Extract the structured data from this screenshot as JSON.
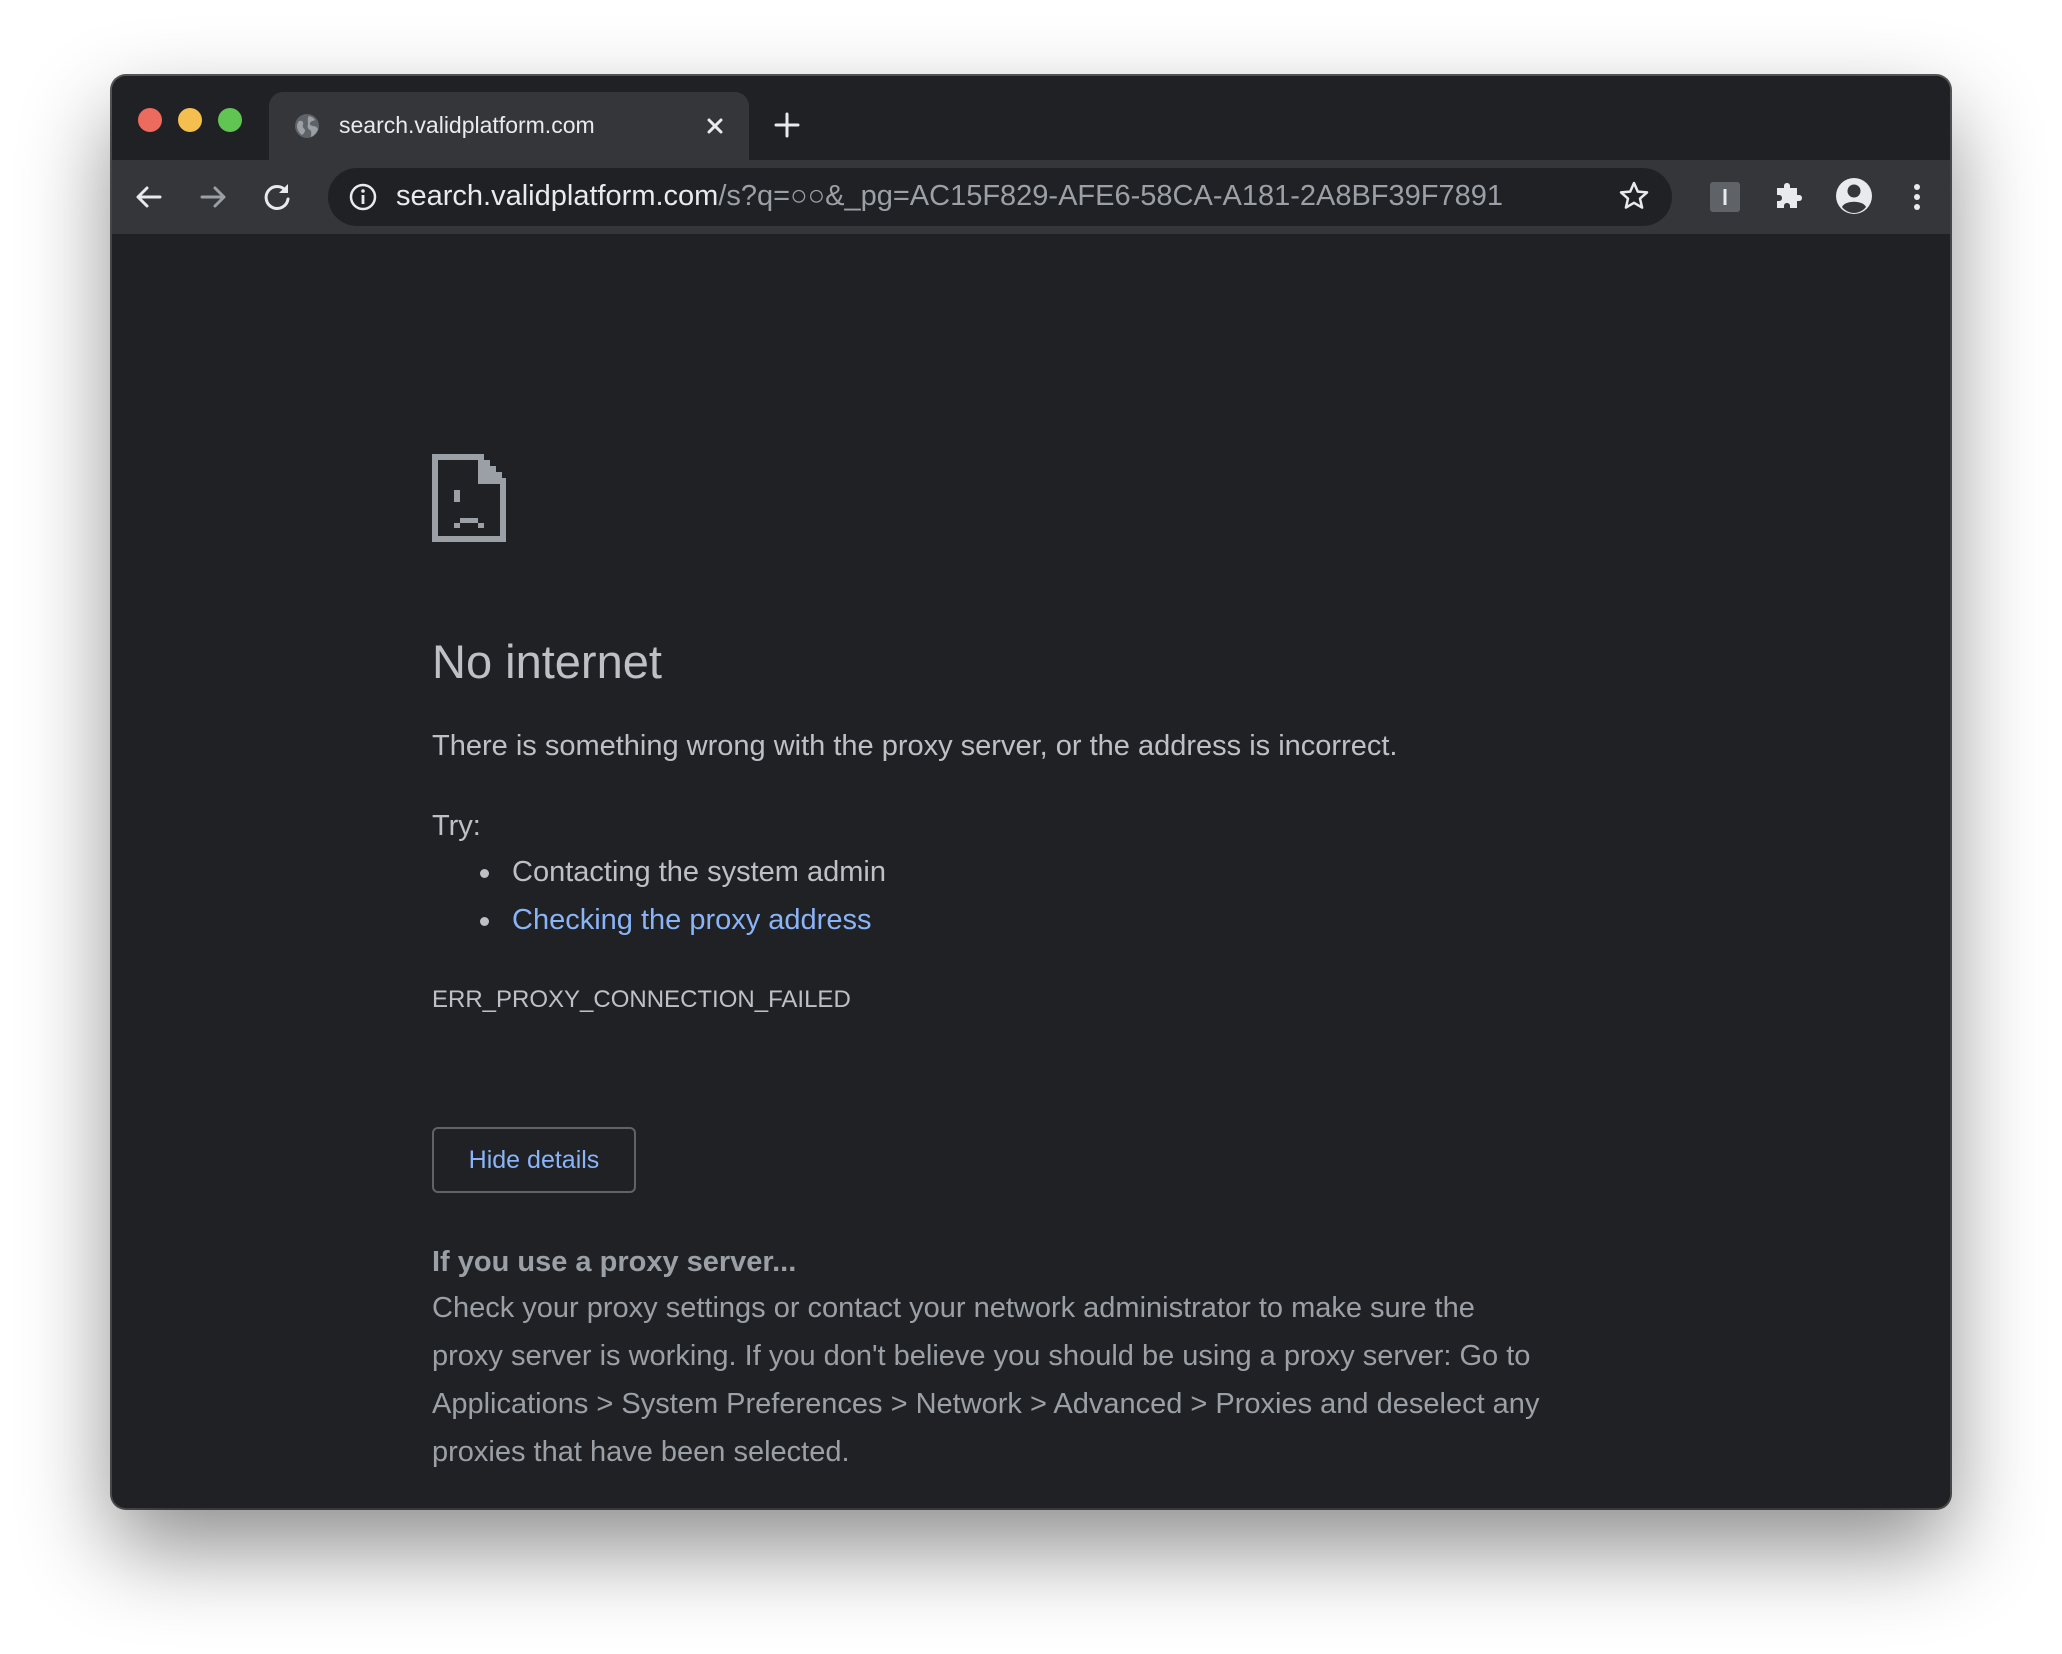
{
  "tab": {
    "title": "search.validplatform.com",
    "favicon": "globe-icon",
    "close_icon": "close-icon",
    "new_tab_icon": "plus-icon"
  },
  "toolbar": {
    "back_icon": "arrow-left-icon",
    "forward_icon": "arrow-right-icon",
    "reload_icon": "reload-icon",
    "omnibox": {
      "site_info_icon": "info-icon",
      "url_host": "search.validplatform.com",
      "url_path": "/s?q=○○&_pg=AC15F829-AFE6-58CA-A181-2A8BF39F7891",
      "bookmark_icon": "star-icon"
    },
    "extension_icon": "extension-badge-icon",
    "extensions_icon": "puzzle-icon",
    "profile_icon": "account-icon",
    "menu_icon": "kebab-menu-icon"
  },
  "error_page": {
    "icon": "sad-page-icon",
    "heading": "No internet",
    "summary": "There is something wrong with the proxy server, or the address is incorrect.",
    "try_label": "Try:",
    "suggestions": [
      "Contacting the system admin",
      "Checking the proxy address"
    ],
    "error_code": "ERR_PROXY_CONNECTION_FAILED",
    "details_button": "Hide details",
    "details_heading": "If you use a proxy server...",
    "details_lines": [
      "Check your proxy settings or contact your network administrator to make sure the",
      "proxy server is working. If you don't believe you should be using a proxy server: Go to",
      "Applications > System Preferences > Network > Advanced > Proxies and deselect any",
      "proxies that have been selected."
    ]
  },
  "colors": {
    "window_bg": "#202124",
    "toolbar_bg": "#35363a",
    "text": "#bdc1c6",
    "muted_text": "#9aa0a6",
    "link": "#8ab4f8",
    "traffic_red": "#ed6a5e",
    "traffic_yellow": "#f4bf4f",
    "traffic_green": "#61c554"
  }
}
